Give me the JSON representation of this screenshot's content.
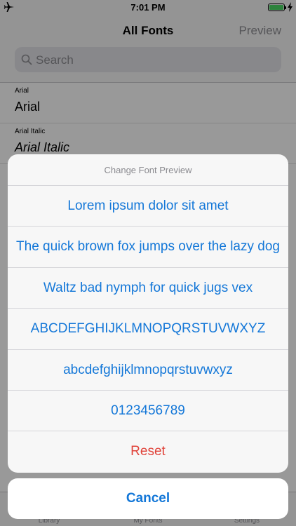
{
  "status_bar": {
    "time": "7:01 PM"
  },
  "nav": {
    "title": "All Fonts",
    "right_button": "Preview"
  },
  "search": {
    "placeholder": "Search"
  },
  "fonts": [
    {
      "name": "Arial",
      "preview": "Arial",
      "style": "normal"
    },
    {
      "name": "Arial Italic",
      "preview": "Arial Italic",
      "style": "italic"
    }
  ],
  "tabs": [
    "Library",
    "My Fonts",
    "Settings"
  ],
  "action_sheet": {
    "title": "Change Font Preview",
    "options": [
      "Lorem ipsum dolor sit amet",
      "The quick brown fox jumps over the lazy dog",
      "Waltz bad nymph for quick jugs vex",
      "ABCDEFGHIJKLMNOPQRSTUVWXYZ",
      "abcdefghijklmnopqrstuvwxyz",
      "0123456789"
    ],
    "reset_label": "Reset",
    "cancel_label": "Cancel"
  },
  "colors": {
    "accent": "#1377d8",
    "destructive": "#e0433a",
    "battery": "#4cd964"
  },
  "icons": [
    "airplane-icon",
    "battery-icon",
    "charging-icon",
    "search-icon"
  ]
}
